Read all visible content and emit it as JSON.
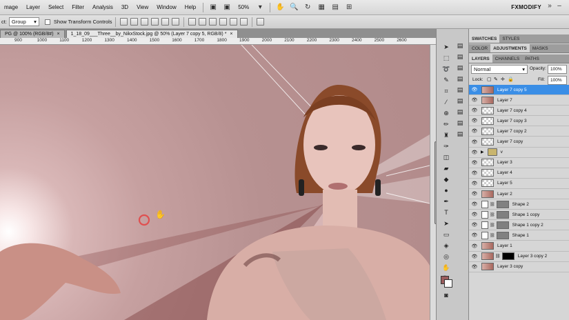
{
  "menu": {
    "items": [
      "mage",
      "Layer",
      "Select",
      "Filter",
      "Analysis",
      "3D",
      "View",
      "Window",
      "Help"
    ],
    "zoom": "50%",
    "brand": "FXMODIFY"
  },
  "options": {
    "label": "ct:",
    "mode_value": "Group",
    "transform_label": "Show Transform Controls"
  },
  "tabs": [
    {
      "label": "PG @ 100% (RGB/8#)",
      "close": "×"
    },
    {
      "label": "1_18_09___Three__by_NikxStock.jpg @ 50% (Layer 7 copy 5, RGB/8) *",
      "close": "×"
    }
  ],
  "ruler": [
    "900",
    "1000",
    "1100",
    "1200",
    "1300",
    "1400",
    "1500",
    "1600",
    "1700",
    "1800",
    "1900",
    "2000",
    "2100",
    "2200",
    "2300",
    "2400",
    "2500",
    "2600"
  ],
  "panels": {
    "top_tabs": [
      "SWATCHES",
      "STYLES"
    ],
    "mid_tabs": [
      "COLOR",
      "ADJUSTMENTS",
      "MASKS"
    ],
    "layer_tabs": [
      "LAYERS",
      "CHANNELS",
      "PATHS"
    ],
    "blend_mode": "Normal",
    "opacity_label": "Opacity:",
    "opacity_value": "100%",
    "lock_label": "Lock:",
    "fill_label": "Fill:",
    "fill_value": "100%"
  },
  "layers": [
    {
      "name": "Layer 7 copy 5",
      "thumb": "photo",
      "selected": true
    },
    {
      "name": "Layer 7",
      "thumb": "photo"
    },
    {
      "name": "Layer 7 copy 4",
      "thumb": "checker"
    },
    {
      "name": "Layer 7 copy 3",
      "thumb": "checker"
    },
    {
      "name": "Layer 7 copy 2",
      "thumb": "checker"
    },
    {
      "name": "Layer 7 copy",
      "thumb": "checker"
    },
    {
      "name": "v",
      "thumb": "folder",
      "group": true
    },
    {
      "name": "Layer 3",
      "thumb": "checker"
    },
    {
      "name": "Layer 4",
      "thumb": "checker"
    },
    {
      "name": "Layer 5",
      "thumb": "checker"
    },
    {
      "name": "Layer 2",
      "thumb": "photo"
    },
    {
      "name": "Shape 2",
      "thumb": "white",
      "mask": "shape"
    },
    {
      "name": "Shape 1 copy",
      "thumb": "white",
      "mask": "shape"
    },
    {
      "name": "Shape 1 copy 2",
      "thumb": "white",
      "mask": "shape"
    },
    {
      "name": "Shape 1",
      "thumb": "white",
      "mask": "shape"
    },
    {
      "name": "Layer 1",
      "thumb": "photo"
    },
    {
      "name": "Layer 3 copy 2",
      "thumb": "photo",
      "mask": "black"
    },
    {
      "name": "Layer 3 copy",
      "thumb": "photo"
    }
  ],
  "colors": {
    "selection": "#3a8ee6",
    "foreground": "#9a5c5c",
    "background": "#ffffff",
    "cursor_ring": "#e05050"
  }
}
